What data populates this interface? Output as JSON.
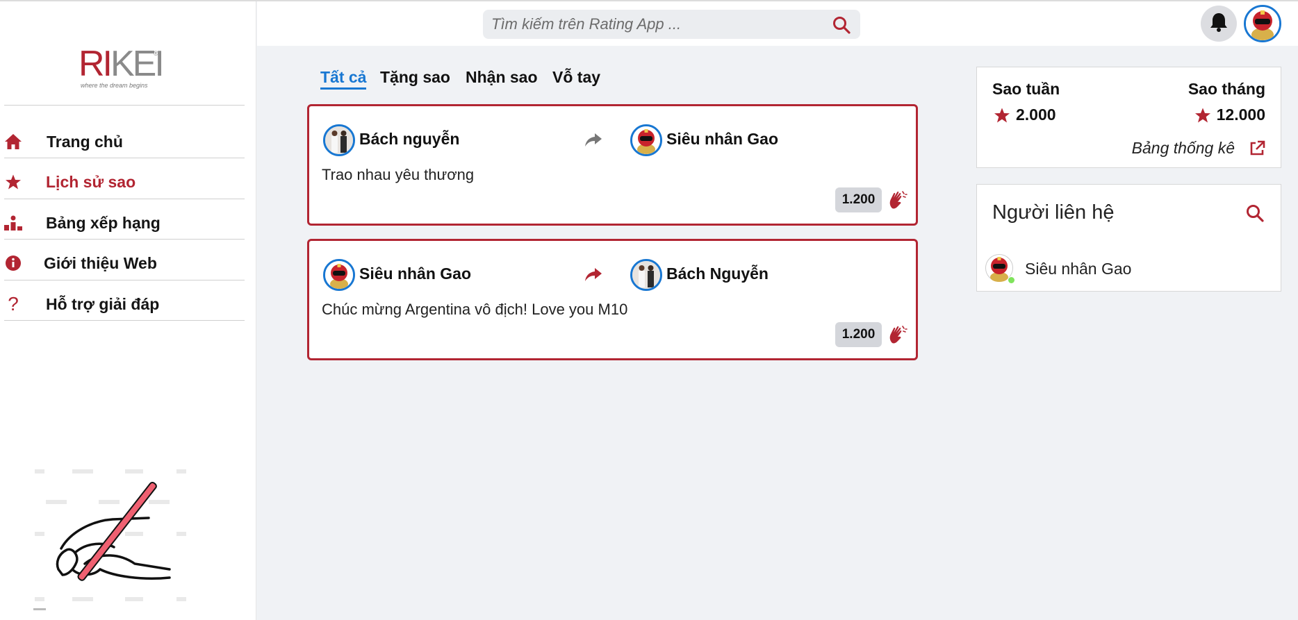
{
  "brand": {
    "logo_text_r": "RI",
    "logo_text_rest": "KEI",
    "logo_reg": "®",
    "tagline": "where the dream begins"
  },
  "search": {
    "placeholder": "Tìm kiếm trên Rating App ..."
  },
  "sidebar": {
    "items": [
      {
        "label": "Trang chủ",
        "icon": "home-icon"
      },
      {
        "label": "Lịch sử sao",
        "icon": "star-icon",
        "active": true
      },
      {
        "label": "Bảng xếp hạng",
        "icon": "podium-icon"
      },
      {
        "label": "Giới thiệu Web",
        "icon": "info-icon"
      },
      {
        "label": "Hỗ trợ giải đáp",
        "icon": "question-icon"
      }
    ]
  },
  "tabs": [
    {
      "label": "Tất cả",
      "active": true
    },
    {
      "label": "Tặng sao"
    },
    {
      "label": "Nhận sao"
    },
    {
      "label": "Vỗ tay"
    }
  ],
  "feed": [
    {
      "sender": "Bách nguyễn",
      "receiver": "Siêu nhân Gao",
      "message": "Trao nhau yêu thương",
      "stars": "1.200",
      "arrow_color": "#777777"
    },
    {
      "sender": "Siêu nhân Gao",
      "receiver": "Bách Nguyễn",
      "message": "Chúc mừng Argentina vô địch! Love you M10",
      "stars": "1.200",
      "arrow_color": "#b22532"
    }
  ],
  "stats": {
    "week_label": "Sao tuần",
    "week_value": "2.000",
    "month_label": "Sao tháng",
    "month_value": "12.000",
    "link_label": "Bảng thống kê"
  },
  "contacts": {
    "title": "Người liên hệ",
    "items": [
      {
        "name": "Siêu nhân Gao",
        "online": true
      }
    ]
  },
  "colors": {
    "accent": "#b22532",
    "link_blue": "#1877d2",
    "background": "#f0f2f5",
    "online": "#7fe35c"
  }
}
